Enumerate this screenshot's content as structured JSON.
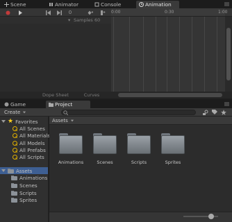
{
  "top_tabs": [
    {
      "label": "Scene",
      "icon": "scene-icon"
    },
    {
      "label": "Animator",
      "icon": "animator-icon"
    },
    {
      "label": "Console",
      "icon": "console-icon"
    },
    {
      "label": "Animation",
      "icon": "animation-icon"
    }
  ],
  "animation": {
    "frame_value": "0",
    "samples_label": "Samples",
    "samples_value": "60",
    "ruler_ticks": [
      "0:00",
      "0:30",
      "1:00"
    ],
    "dopesheet_label": "Dope Sheet",
    "curves_label": "Curves"
  },
  "lower_tabs": [
    {
      "label": "Game",
      "icon": "game-icon"
    },
    {
      "label": "Project",
      "icon": "project-icon"
    }
  ],
  "project": {
    "create_label": "Create",
    "search_placeholder": "",
    "breadcrumb": "Assets",
    "favorites_label": "Favorites",
    "favorites": [
      "All Scenes",
      "All Materials",
      "All Models",
      "All Prefabs",
      "All Scripts"
    ],
    "assets_label": "Assets",
    "asset_children": [
      "Animations",
      "Scenes",
      "Scripts",
      "Sprites"
    ],
    "grid_items": [
      "Animations",
      "Scenes",
      "Scripts",
      "Sprites"
    ]
  },
  "colors": {
    "selection": "#3e5f93",
    "favorite_star": "#ffd21f",
    "record_red": "#c23b3b"
  }
}
